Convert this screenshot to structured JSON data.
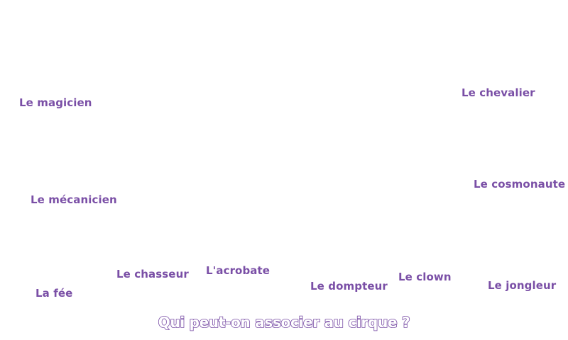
{
  "theme": {
    "word_color": "#7a4fa6",
    "background": "#ffffff"
  },
  "words": [
    {
      "id": "magicien",
      "label": "Le magicien"
    },
    {
      "id": "chevalier",
      "label": "Le chevalier"
    },
    {
      "id": "cosmonaute",
      "label": "Le cosmonaute"
    },
    {
      "id": "mecanicien",
      "label": "Le mécanicien"
    },
    {
      "id": "chasseur",
      "label": "Le chasseur"
    },
    {
      "id": "acrobate",
      "label": "L'acrobate"
    },
    {
      "id": "dompteur",
      "label": "Le dompteur"
    },
    {
      "id": "clown",
      "label": "Le clown"
    },
    {
      "id": "jongleur",
      "label": "Le jongleur"
    },
    {
      "id": "fee",
      "label": "La fée"
    }
  ],
  "question": "Qui peut-on associer au cirque ?"
}
